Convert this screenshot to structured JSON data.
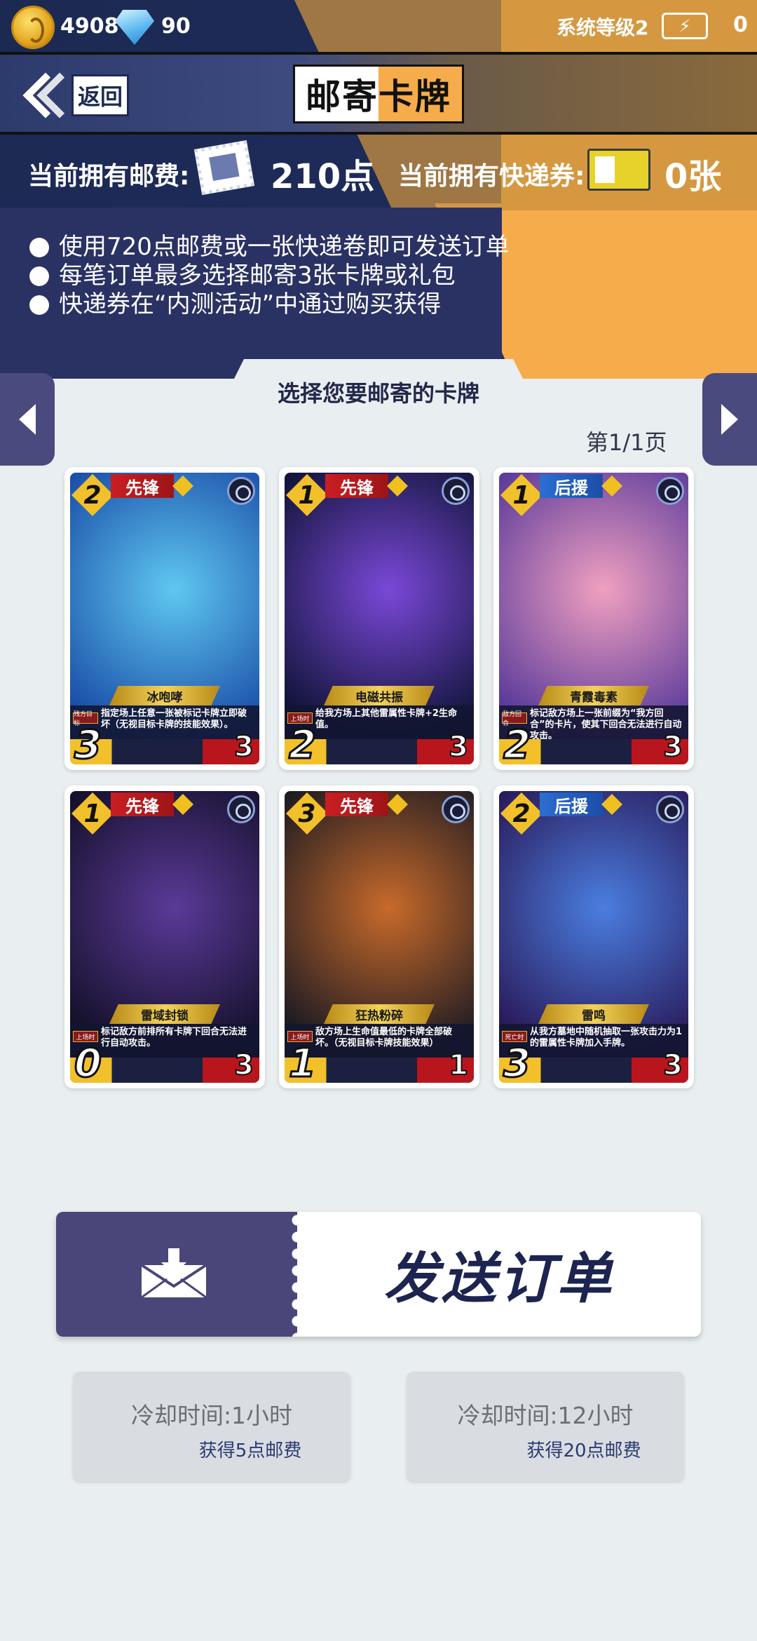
{
  "status_bar": {
    "coins": "4908",
    "gems": "90",
    "system_level": "系统等级2",
    "energy": "0",
    "icons": [
      "coin-icon",
      "gem-icon",
      "energy-icon"
    ]
  },
  "header": {
    "back_label": "返回",
    "title": "邮寄卡牌"
  },
  "currency": {
    "postage_label": "当前拥有邮费:",
    "postage_value": "210点",
    "ticket_label": "当前拥有快递券:",
    "ticket_value": "0张"
  },
  "rules": [
    "使用720点邮费或一张快递卷即可发送订单",
    "每笔订单最多选择邮寄3张卡牌或礼包",
    "快递券在“内测活动”中通过购买获得"
  ],
  "selection": {
    "title": "选择您要邮寄的卡牌",
    "page_indicator": "第1/1页"
  },
  "cards": [
    {
      "cost": "2",
      "type": "先锋",
      "name": "冰咆哮",
      "keyword": "残方目标",
      "desc": "指定场上任意一张被标记卡牌立即破坏（无视目标卡牌的技能效果）。",
      "attack": "3",
      "hp": "3",
      "art_a": "#5fc8f0",
      "art_b": "#1a4ea8",
      "support": false
    },
    {
      "cost": "1",
      "type": "先锋",
      "name": "电磁共振",
      "keyword": "上场时",
      "desc": "给我方场上其他雷属性卡牌+2生命值。",
      "attack": "2",
      "hp": "3",
      "art_a": "#7a48d8",
      "art_b": "#101438",
      "support": false
    },
    {
      "cost": "1",
      "type": "后援",
      "name": "青霞毒素",
      "keyword": "敌方回合",
      "desc": "标记敌方场上一张前缀为“我方回合”的卡片，使其下回合无法进行自动攻击。",
      "attack": "2",
      "hp": "3",
      "art_a": "#f0a0c0",
      "art_b": "#5a3a9a",
      "support": true
    },
    {
      "cost": "1",
      "type": "先锋",
      "name": "雷域封锁",
      "keyword": "上场时",
      "desc": "标记敌方前排所有卡牌下回合无法进行自动攻击。",
      "attack": "0",
      "hp": "3",
      "art_a": "#5a3a98",
      "art_b": "#14102a",
      "support": false
    },
    {
      "cost": "3",
      "type": "先锋",
      "name": "狂热粉碎",
      "keyword": "上场时",
      "desc": "敌方场上生命值最低的卡牌全部破坏。（无视目标卡牌技能效果）",
      "attack": "1",
      "hp": "1",
      "art_a": "#c86a2a",
      "art_b": "#1c1a22",
      "support": false
    },
    {
      "cost": "2",
      "type": "后援",
      "name": "雷鸣",
      "keyword": "死亡时",
      "desc": "从我方墓地中随机抽取一张攻击力为1的雷属性卡牌加入手牌。",
      "attack": "3",
      "hp": "3",
      "art_a": "#4a7ee0",
      "art_b": "#2a1a5a",
      "support": true
    }
  ],
  "send_order": {
    "label": "发送订单",
    "icon": "mail-download-icon"
  },
  "cooldowns": [
    {
      "time": "冷却时间:1小时",
      "reward": "获得5点邮费"
    },
    {
      "time": "冷却时间:12小时",
      "reward": "获得20点邮费"
    }
  ],
  "colors": {
    "navy": "#1e2b5a",
    "orange": "#f6ac4a",
    "purple_button": "#4a4679",
    "background": "#e9eef0"
  }
}
